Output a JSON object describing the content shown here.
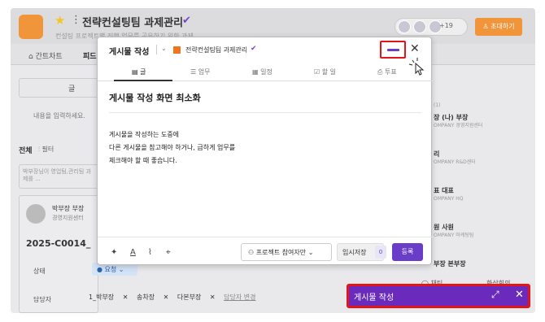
{
  "app": {
    "title": "전략컨설팅팀 과제관리",
    "subtitle": "컨설팅 프로젝트별 진행 업무를 공유하기 위한 과제",
    "members_extra": "+19",
    "invite_label": "초대하기",
    "tabs": [
      "간트차트",
      "피드"
    ]
  },
  "feed": {
    "write_label": "글",
    "input_placeholder": "내용을 입력하세요.",
    "filter_all": "전체",
    "filter_label": "필터",
    "notice": "박부장님이 영업팀,관리팀 과제를 ...",
    "post": {
      "author": "박부장 부장",
      "dept": "경영지원센터",
      "code": "2025-C0014_",
      "status_label": "상태",
      "status_value": "요청",
      "assignee_label": "담당자",
      "assignees": [
        "1_박부장",
        "송차장",
        "다본부장"
      ],
      "assignee_change": "담당자 변경"
    }
  },
  "right_panel": {
    "count": "(1)",
    "items": [
      {
        "name": "장 (나) 부장",
        "sub": "OMPANY 경영지원센터"
      },
      {
        "name": "리",
        "sub": "OMPANY R&D센터"
      },
      {
        "name": "표 대표",
        "sub": "OMPANY HQ"
      },
      {
        "name": "원 사원",
        "sub": "OMPANY 마케팅팀"
      },
      {
        "name": "부장 본부장",
        "sub": ""
      }
    ],
    "chat_label": "채팅",
    "meeting_label": "화상회의"
  },
  "modal": {
    "title": "게시물 작성",
    "project": "전략컨설팅팀 과제관리",
    "tabs": [
      "글",
      "업무",
      "일정",
      "할 일",
      "투표"
    ],
    "post_title": "게시물 작성 화면 최소화",
    "body_lines": [
      "게시물을 작성하는 도중에",
      "다른 게시물을 참고해야 하거나, 급하게 업무를",
      "체크해야 할 때 좋습니다."
    ],
    "scope": "프로젝트 참여자만",
    "draft_label": "임시저장",
    "draft_count": "0",
    "submit": "등록"
  },
  "minimized": {
    "title": "게시물 작성"
  },
  "colors": {
    "accent": "#6a3dc8",
    "brand_orange": "#f0953a",
    "highlight": "#e3141a"
  }
}
